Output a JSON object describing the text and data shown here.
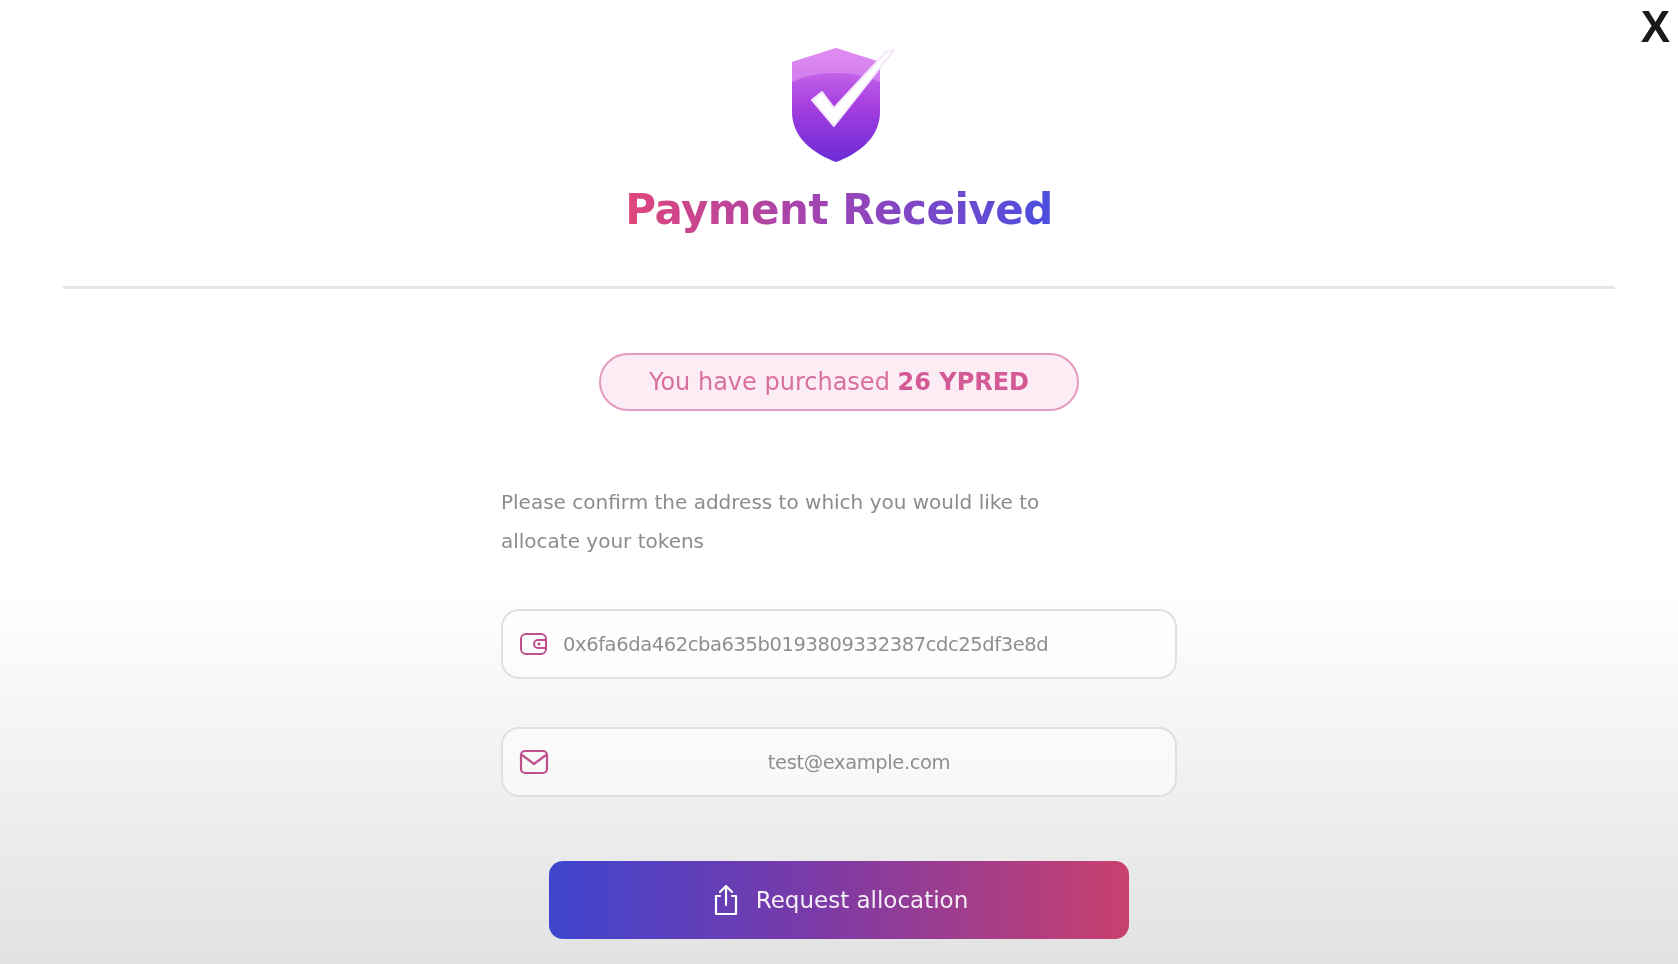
{
  "close_button": {
    "label": "X"
  },
  "title": "Payment Received",
  "purchase_badge": "You have purchased **26 YPRED**",
  "instructions": "Please confirm the address to which you would like to allocate your tokens",
  "fields": [
    {
      "kind": "wallet",
      "value": "0x6fa6da462cba635b0193809332387cdc25df3e8d"
    },
    {
      "kind": "email",
      "value": "test@example.com"
    }
  ],
  "submit_button": {
    "label": "Request allocation"
  }
}
